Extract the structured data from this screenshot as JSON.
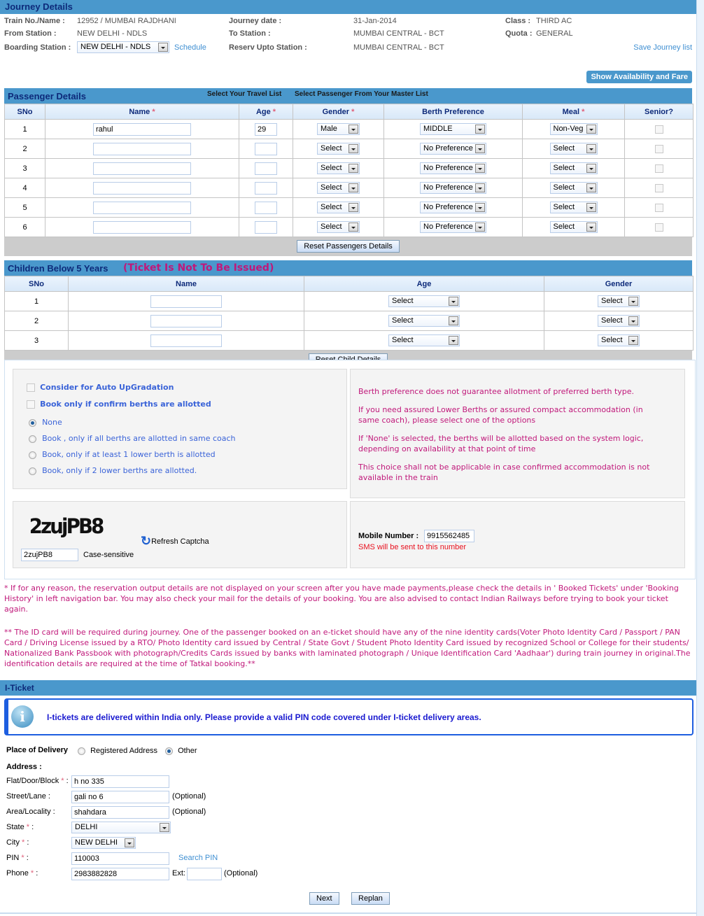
{
  "journey": {
    "header": "Journey Details",
    "train_label": "Train No./Name :",
    "train_value": "12952 / MUMBAI RAJDHANI",
    "from_label": "From Station :",
    "from_value": "NEW DELHI - NDLS",
    "boarding_label": "Boarding Station :",
    "boarding_value": "NEW DELHI - NDLS",
    "schedule_link": "Schedule",
    "date_label": "Journey date :",
    "date_value": "31-Jan-2014",
    "to_label": "To Station :",
    "to_value": "MUMBAI CENTRAL - BCT",
    "reserv_label": "Reserv Upto Station :",
    "reserv_value": "MUMBAI CENTRAL - BCT",
    "class_label": "Class :",
    "class_value": "THIRD AC",
    "quota_label": "Quota :",
    "quota_value": "GENERAL",
    "save_journey_link": "Save Journey list",
    "show_availability_button": "Show Availability and Fare"
  },
  "passengers": {
    "header": "Passenger Details",
    "travel_list_link": "Select Your Travel List",
    "master_list_link": "Select Passenger From Your Master List",
    "columns": [
      "SNo",
      "Name",
      "Age",
      "Gender",
      "Berth Preference",
      "Meal",
      "Senior?"
    ],
    "required_mark": "*",
    "rows": [
      {
        "sno": "1",
        "name": "rahul",
        "age": "29",
        "gender": "Male",
        "berth": "MIDDLE",
        "meal": "Non-Veg",
        "senior": false
      },
      {
        "sno": "2",
        "name": "",
        "age": "",
        "gender": "Select",
        "berth": "No Preference",
        "meal": "Select",
        "senior": false
      },
      {
        "sno": "3",
        "name": "",
        "age": "",
        "gender": "Select",
        "berth": "No Preference",
        "meal": "Select",
        "senior": false
      },
      {
        "sno": "4",
        "name": "",
        "age": "",
        "gender": "Select",
        "berth": "No Preference",
        "meal": "Select",
        "senior": false
      },
      {
        "sno": "5",
        "name": "",
        "age": "",
        "gender": "Select",
        "berth": "No Preference",
        "meal": "Select",
        "senior": false
      },
      {
        "sno": "6",
        "name": "",
        "age": "",
        "gender": "Select",
        "berth": "No Preference",
        "meal": "Select",
        "senior": false
      }
    ],
    "reset_button": "Reset Passengers Details"
  },
  "children": {
    "header": "Children Below 5 Years",
    "header_note": "(Ticket Is Not To Be Issued)",
    "columns": [
      "SNo",
      "Name",
      "Age",
      "Gender"
    ],
    "rows": [
      {
        "sno": "1",
        "name": "",
        "age": "Select",
        "gender": "Select"
      },
      {
        "sno": "2",
        "name": "",
        "age": "Select",
        "gender": "Select"
      },
      {
        "sno": "3",
        "name": "",
        "age": "Select",
        "gender": "Select"
      }
    ],
    "reset_button": "Reset Child Details"
  },
  "options": {
    "auto_upgrade_label": "Consider for Auto UpGradation",
    "confirm_berths_label": "Book only if confirm berths are allotted",
    "radios": [
      {
        "label": "None",
        "checked": true
      },
      {
        "label": "Book , only if all berths are allotted in same coach",
        "checked": false
      },
      {
        "label": "Book, only if at least 1 lower berth is allotted",
        "checked": false
      },
      {
        "label": "Book, only if 2 lower berths are allotted.",
        "checked": false
      }
    ]
  },
  "berth_info": [
    "Berth preference does not guarantee allotment of preferred berth type.",
    "If you need assured Lower Berths or assured compact accommodation (in same coach), please select one of the options",
    "If 'None' is selected, the berths will be allotted based on the system logic, depending on availability at that point of time",
    "This choice shall not be applicable in case confirmed accommodation is not available in the train"
  ],
  "captcha": {
    "image_text": "2zujPB8",
    "input_value": "2zujPB8",
    "case_note": "Case-sensitive",
    "refresh_label": "Refresh Captcha"
  },
  "mobile": {
    "label": "Mobile Number :",
    "value": "9915562485",
    "note": "SMS will be sent to this number"
  },
  "notes": {
    "note1": "* If for any reason, the reservation output details are not displayed on your screen after you have made payments,please check the details in ' Booked Tickets' under 'Booking History' in left navigation bar. You may also check your mail for the details of your booking. You are also advised to contact Indian Railways before trying to book your ticket again.",
    "note2": "** The ID card will be required during journey. One of the passenger booked on an e-ticket should have any of the nine identity cards(Voter Photo Identity Card / Passport / PAN Card / Driving License issued by a RTO/ Photo Identity card issued by Central / State Govt / Student Photo Identity Card issued by recognized School or College for their students/ Nationalized Bank Passbook with photograph/Credits Cards issued by banks with laminated photograph / Unique Identification Card 'Aadhaar') during train journey in original.The identification details are required at the time of Tatkal booking.**"
  },
  "iticket": {
    "header": "I-Ticket",
    "info_icon": "info-icon",
    "info_text": "I-tickets are delivered within India only. Please provide a valid PIN code covered under I-ticket delivery areas.",
    "delivery_label": "Place of Delivery",
    "delivery_options": [
      {
        "label": "Registered Address",
        "checked": false
      },
      {
        "label": "Other",
        "checked": true
      }
    ],
    "address_heading": "Address :",
    "fields": {
      "flat": {
        "label": "Flat/Door/Block",
        "value": "h no 335"
      },
      "street": {
        "label": "Street/Lane :",
        "value": "gali no 6",
        "note": "(Optional)"
      },
      "area": {
        "label": "Area/Locality :",
        "value": "shahdara",
        "note": "(Optional)"
      },
      "state": {
        "label": "State",
        "value": "DELHI"
      },
      "city": {
        "label": "City",
        "value": "NEW DELHI"
      },
      "pin": {
        "label": "PIN",
        "value": "110003",
        "link": "Search PIN"
      },
      "phone": {
        "label": "Phone",
        "value": "2983882828",
        "ext_label": "Ext:",
        "ext_value": "",
        "note": "(Optional)"
      }
    },
    "colon": ":",
    "required_mark": "*",
    "next_button": "Next",
    "replan_button": "Replan"
  }
}
